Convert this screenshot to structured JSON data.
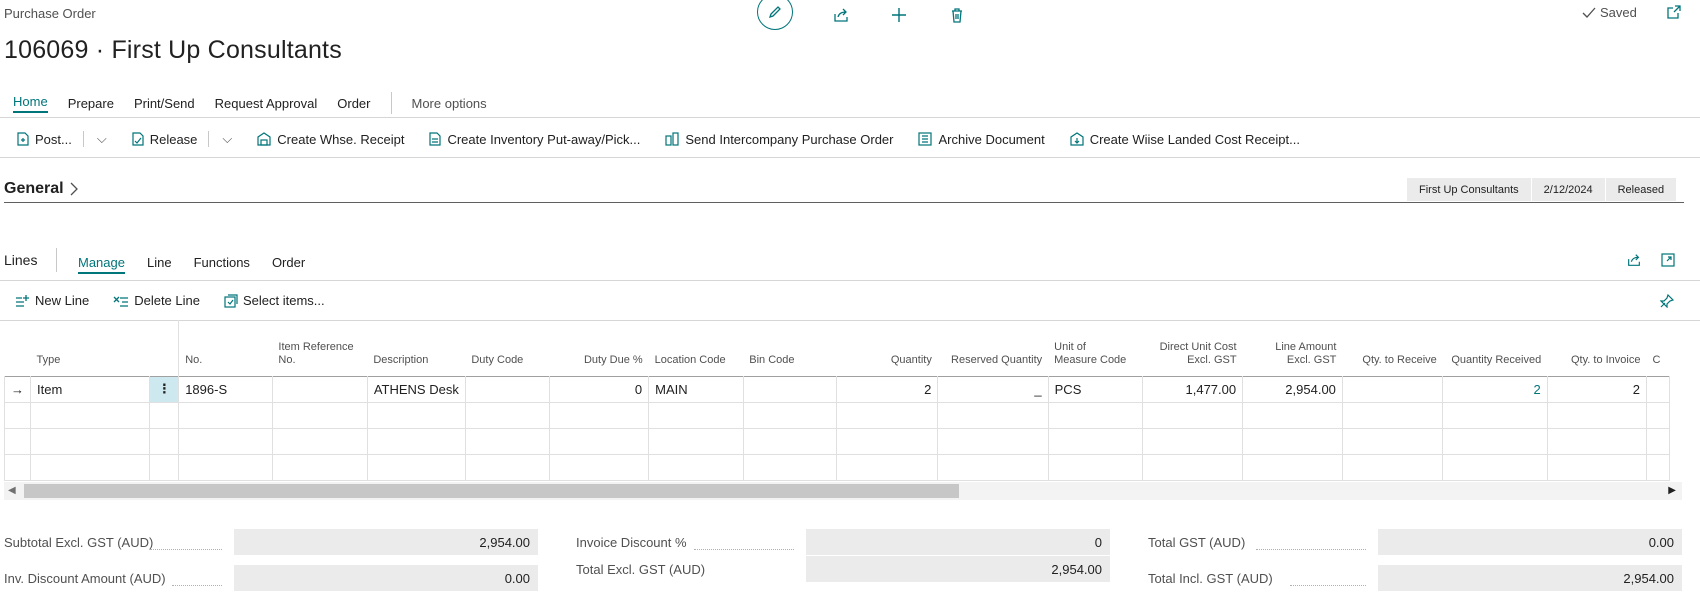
{
  "header": {
    "breadcrumb": "Purchase Order",
    "title": "106069 · First Up Consultants",
    "saved_label": "Saved",
    "icons": [
      "edit-icon",
      "share-icon",
      "add-icon",
      "delete-icon",
      "popout-icon"
    ]
  },
  "tabs": [
    {
      "label": "Home",
      "active": true
    },
    {
      "label": "Prepare"
    },
    {
      "label": "Print/Send"
    },
    {
      "label": "Request Approval"
    },
    {
      "label": "Order"
    }
  ],
  "more_options": "More options",
  "actions": {
    "post": "Post...",
    "release": "Release",
    "create_whse_receipt": "Create Whse. Receipt",
    "create_inventory": "Create Inventory Put-away/Pick...",
    "send_intercompany": "Send Intercompany Purchase Order",
    "archive": "Archive Document",
    "create_wiise": "Create Wiise Landed Cost Receipt..."
  },
  "general": {
    "title": "General",
    "badges": [
      "First Up Consultants",
      "2/12/2024",
      "Released"
    ]
  },
  "lines": {
    "title": "Lines",
    "tabs": [
      {
        "label": "Manage",
        "active": true
      },
      {
        "label": "Line"
      },
      {
        "label": "Functions"
      },
      {
        "label": "Order"
      }
    ],
    "actions": {
      "new_line": "New Line",
      "delete_line": "Delete Line",
      "select_items": "Select items..."
    },
    "columns": {
      "type": "Type",
      "no": "No.",
      "item_ref_1": "Item Reference",
      "item_ref_2": "No.",
      "description": "Description",
      "duty_code": "Duty Code",
      "duty_due": "Duty Due %",
      "location": "Location Code",
      "bin": "Bin Code",
      "quantity": "Quantity",
      "reserved": "Reserved Quantity",
      "uom_1": "Unit of",
      "uom_2": "Measure Code",
      "unit_cost_1": "Direct Unit Cost",
      "unit_cost_2": "Excl. GST",
      "line_amount_1": "Line Amount",
      "line_amount_2": "Excl. GST",
      "qty_to_receive": "Qty. to Receive",
      "qty_received": "Quantity Received",
      "qty_to_invoice": "Qty. to Invoice",
      "overflow": "C"
    },
    "rows": [
      {
        "type": "Item",
        "no": "1896-S",
        "item_ref": "",
        "description": "ATHENS Desk",
        "duty_code": "",
        "duty_due": "0",
        "location": "MAIN",
        "bin": "",
        "quantity": "2",
        "reserved": "_",
        "uom": "PCS",
        "unit_cost": "1,477.00",
        "line_amount": "2,954.00",
        "qty_to_receive": "",
        "qty_received": "2",
        "qty_to_invoice": "2"
      }
    ]
  },
  "totals": {
    "subtotal_label": "Subtotal Excl. GST (AUD)",
    "subtotal_value": "2,954.00",
    "inv_discount_amount_label": "Inv. Discount Amount (AUD)",
    "inv_discount_amount_value": "0.00",
    "invoice_discount_pct_label": "Invoice Discount %",
    "invoice_discount_pct_value": "0",
    "total_excl_label": "Total Excl. GST (AUD)",
    "total_excl_value": "2,954.00",
    "total_gst_label": "Total GST (AUD)",
    "total_gst_value": "0.00",
    "total_incl_label": "Total Incl. GST (AUD)",
    "total_incl_value": "2,954.00"
  }
}
